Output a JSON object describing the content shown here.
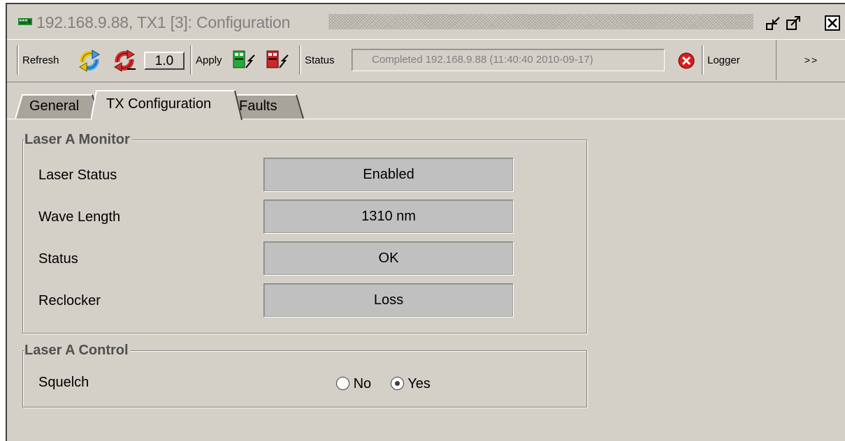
{
  "window": {
    "title": "192.168.9.88, TX1  [3]: Configuration"
  },
  "toolbar": {
    "refresh_label": "Refresh",
    "refresh_interval": "1.0",
    "apply_label": "Apply",
    "status_label": "Status",
    "status_text": "Completed 192.168.9.88 (11:40:40  2010-09-17)",
    "logger_label": "Logger",
    "more_label": ">>"
  },
  "tabs": [
    {
      "label": "General",
      "active": false
    },
    {
      "label": "TX Configuration",
      "active": true
    },
    {
      "label": "Faults",
      "active": false
    }
  ],
  "monitor": {
    "title": "Laser A Monitor",
    "rows": [
      {
        "label": "Laser Status",
        "value": "Enabled"
      },
      {
        "label": "Wave Length",
        "value": "1310 nm"
      },
      {
        "label": "Status",
        "value": "OK"
      },
      {
        "label": "Reclocker",
        "value": "Loss"
      }
    ]
  },
  "control": {
    "title": "Laser A Control",
    "squelch_label": "Squelch",
    "options": [
      {
        "label": "No",
        "selected": false
      },
      {
        "label": "Yes",
        "selected": true
      }
    ]
  }
}
